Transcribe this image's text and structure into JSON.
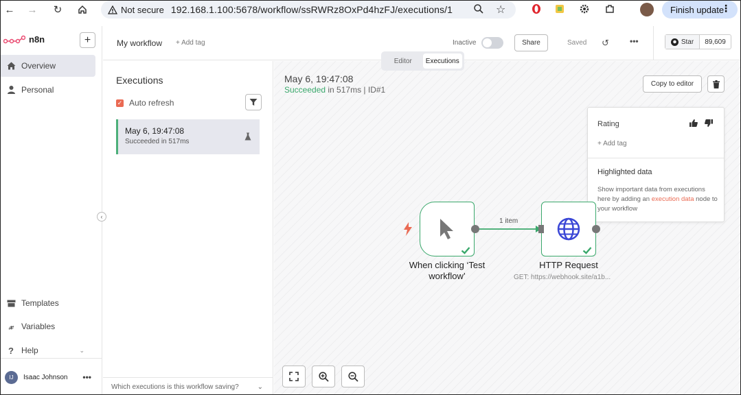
{
  "browser": {
    "security_label": "Not secure",
    "url": "192.168.1.100:5678/workflow/ssRWRz8OxPd4hzFJ/executions/1",
    "finish_update_label": "Finish update"
  },
  "sidebar": {
    "brand": "n8n",
    "items": [
      {
        "label": "Overview",
        "icon": "home-icon"
      },
      {
        "label": "Personal",
        "icon": "user-icon"
      },
      {
        "label": "Templates",
        "icon": "box-icon"
      },
      {
        "label": "Variables",
        "icon": "variable-icon"
      },
      {
        "label": "Help",
        "icon": "question-icon"
      }
    ],
    "user": {
      "initials": "IJ",
      "name": "Isaac Johnson"
    }
  },
  "header": {
    "workflow_name": "My workflow",
    "add_tag": "+ Add tag",
    "active_status": "Inactive",
    "share_label": "Share",
    "saved_label": "Saved",
    "github_star_label": "Star",
    "github_star_count": "89,609",
    "tabs": [
      {
        "label": "Editor",
        "active": false
      },
      {
        "label": "Executions",
        "active": true
      }
    ]
  },
  "executions": {
    "title": "Executions",
    "auto_refresh_label": "Auto refresh",
    "auto_refresh_checked": true,
    "items": [
      {
        "date": "May 6, 19:47:08",
        "status": "Succeeded in 517ms"
      }
    ],
    "footer_question": "Which executions is this workflow saving?"
  },
  "canvas": {
    "execution_date": "May 6, 19:47:08",
    "status_word": "Succeeded",
    "status_rest": " in 517ms | ID#1",
    "copy_button": "Copy to editor",
    "info_panel": {
      "rating_label": "Rating",
      "add_tag": "+ Add tag",
      "highlighted_title": "Highlighted data",
      "desc_before": "Show important data from executions here by adding an ",
      "desc_link": "execution data",
      "desc_after": " node to your workflow"
    },
    "nodes": [
      {
        "label": "When clicking ‘Test workflow’",
        "icon": "cursor-icon"
      },
      {
        "label": "HTTP Request",
        "subtitle": "GET: https://webhook.site/a1b...",
        "icon": "globe-icon"
      }
    ],
    "connection_label": "1 item",
    "colors": {
      "success": "#3aa86b",
      "accent": "#ea6a53",
      "node_icon": "#3a46d6"
    }
  }
}
